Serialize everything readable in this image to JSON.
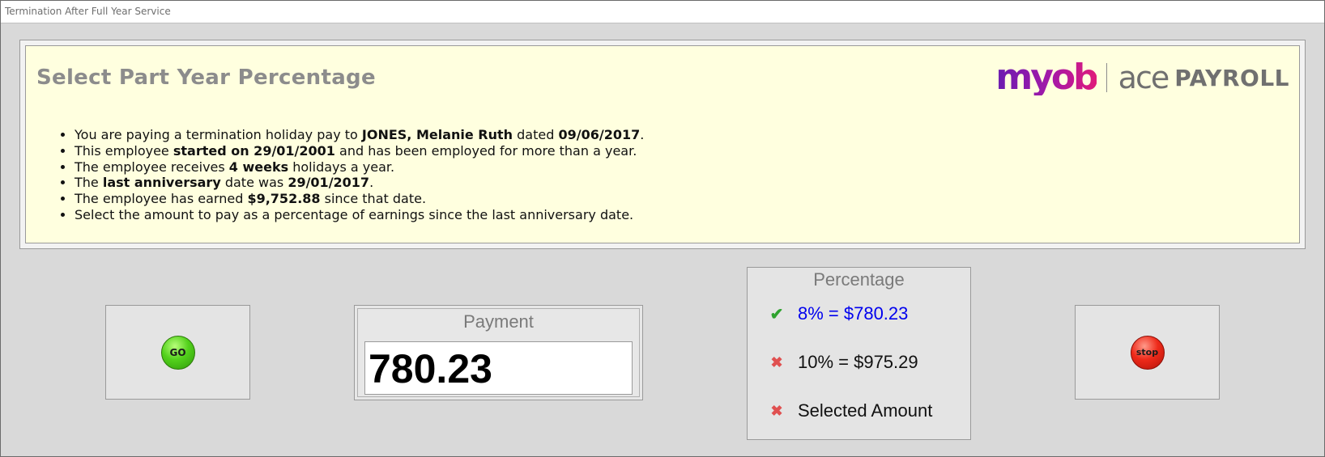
{
  "window": {
    "title": "Termination After Full Year Service"
  },
  "info": {
    "heading": "Select Part Year Percentage",
    "logo": {
      "brand": "myob",
      "product": "ace",
      "suffix": "PAYROLL"
    },
    "lines": [
      {
        "pre": "You are paying a termination holiday pay to ",
        "b1": "JONES, Melanie Ruth",
        "mid": " dated ",
        "b2": "09/06/2017",
        "post": "."
      },
      {
        "pre": "This employee ",
        "b1": "started on 29/01/2001",
        "post": " and has been employed for more than a year."
      },
      {
        "pre": "The employee receives ",
        "b1": "4 weeks",
        "post": " holidays a year."
      },
      {
        "pre": "The ",
        "b1": "last anniversary",
        "mid": " date was ",
        "b2": "29/01/2017",
        "post": "."
      },
      {
        "pre": "The employee has earned ",
        "b1": "$9,752.88",
        "post": " since that date."
      },
      {
        "pre": "Select the amount to pay as a percentage of earnings since the last anniversary date."
      }
    ]
  },
  "buttons": {
    "go_label": "GO",
    "stop_label": "stop"
  },
  "payment": {
    "label": "Payment",
    "value": "780.23"
  },
  "percentage": {
    "label": "Percentage",
    "options": [
      {
        "text": "8% = $780.23",
        "selected": true,
        "icon": "check-icon"
      },
      {
        "text": "10% = $975.29",
        "selected": false,
        "icon": "cross-icon"
      },
      {
        "text": "Selected Amount",
        "selected": false,
        "icon": "cross-icon"
      }
    ]
  },
  "colors": {
    "panel_bg": "#ffffdf",
    "selected_text": "#0000ee",
    "go_green": "#53d11c",
    "stop_red": "#ee2a1a",
    "myob_purple": "#6a1bb0",
    "myob_pink": "#e01a7a"
  }
}
